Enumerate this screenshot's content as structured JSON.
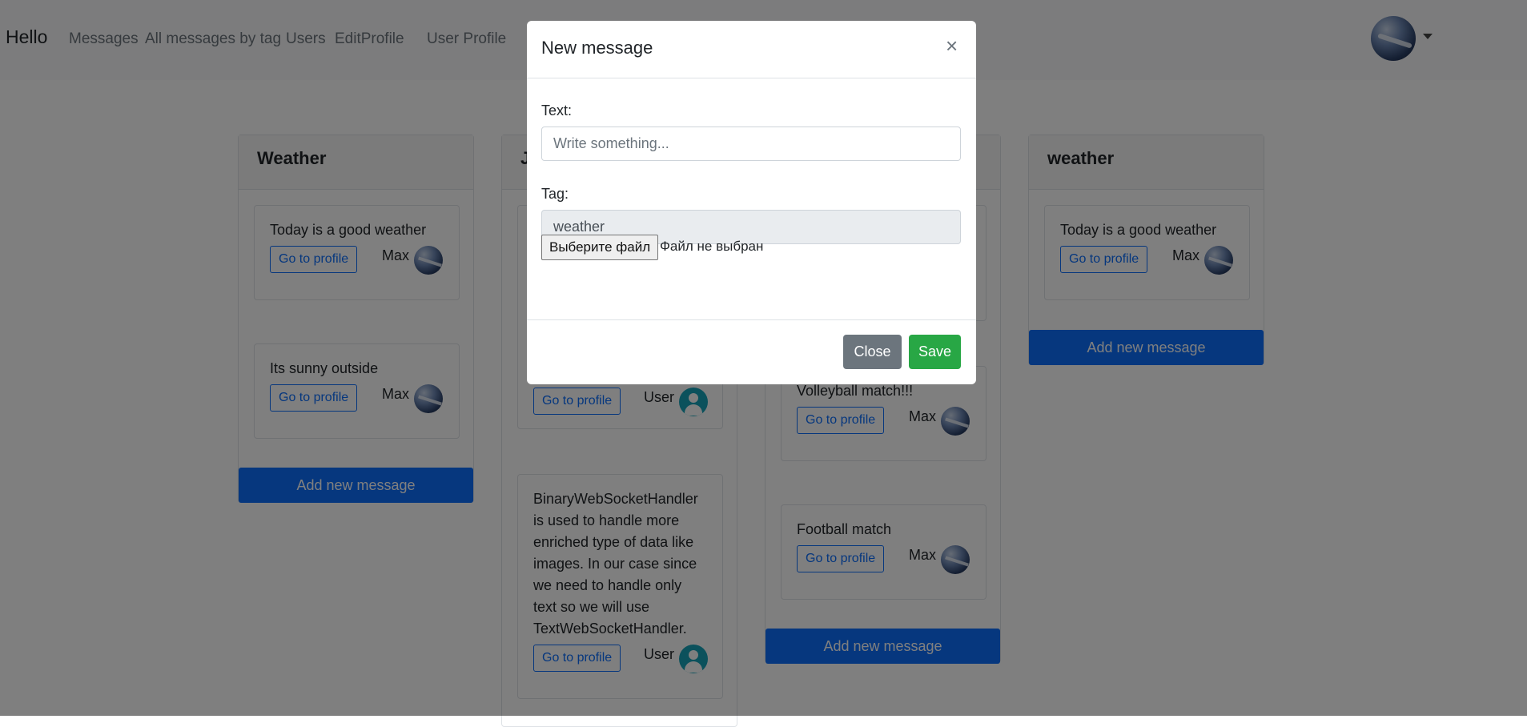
{
  "navbar": {
    "brand": "Hello",
    "links": [
      "Messages",
      "All messages by tag",
      "Users",
      "EditProfile",
      "User Profile"
    ]
  },
  "columns": [
    {
      "title": "Weather",
      "cards": [
        {
          "text": "Today is a good weather",
          "button": "Go to profile",
          "author": "Max"
        },
        {
          "text": "Its sunny outside",
          "button": "Go to profile",
          "author": "Max"
        }
      ],
      "add_label": "Add new message"
    },
    {
      "title": "J",
      "cards": [
        {
          "text": "",
          "button": "Go to profile",
          "author": "User"
        },
        {
          "text": "BinaryWebSocketHandler is used to handle more enriched type of data like images. In our case since we need to handle only text so we will use TextWebSocketHandler.",
          "button": "Go to profile",
          "author": "User"
        }
      ]
    },
    {
      "title": "",
      "cards": [
        {
          "text": "Volleyball match!!!",
          "button": "Go to profile",
          "author": "Max"
        },
        {
          "text": "Football match",
          "button": "Go to profile",
          "author": "Max"
        }
      ],
      "add_label": "Add new message"
    },
    {
      "title": "weather",
      "cards": [
        {
          "text": "Today is a good weather",
          "button": "Go to profile",
          "author": "Max"
        }
      ],
      "add_label": "Add new message"
    }
  ],
  "modal": {
    "title": "New message",
    "close_glyph": "×",
    "text_label": "Text:",
    "text_placeholder": "Write something...",
    "tag_label": "Tag:",
    "tag_value": "weather",
    "file_button": "Выберите файл",
    "file_status": "Файл не выбран",
    "close_label": "Close",
    "save_label": "Save"
  },
  "colors": {
    "primary": "#0d6efd",
    "success": "#28a745",
    "secondary": "#6c757d",
    "user_avatar": "#17a2b8"
  }
}
